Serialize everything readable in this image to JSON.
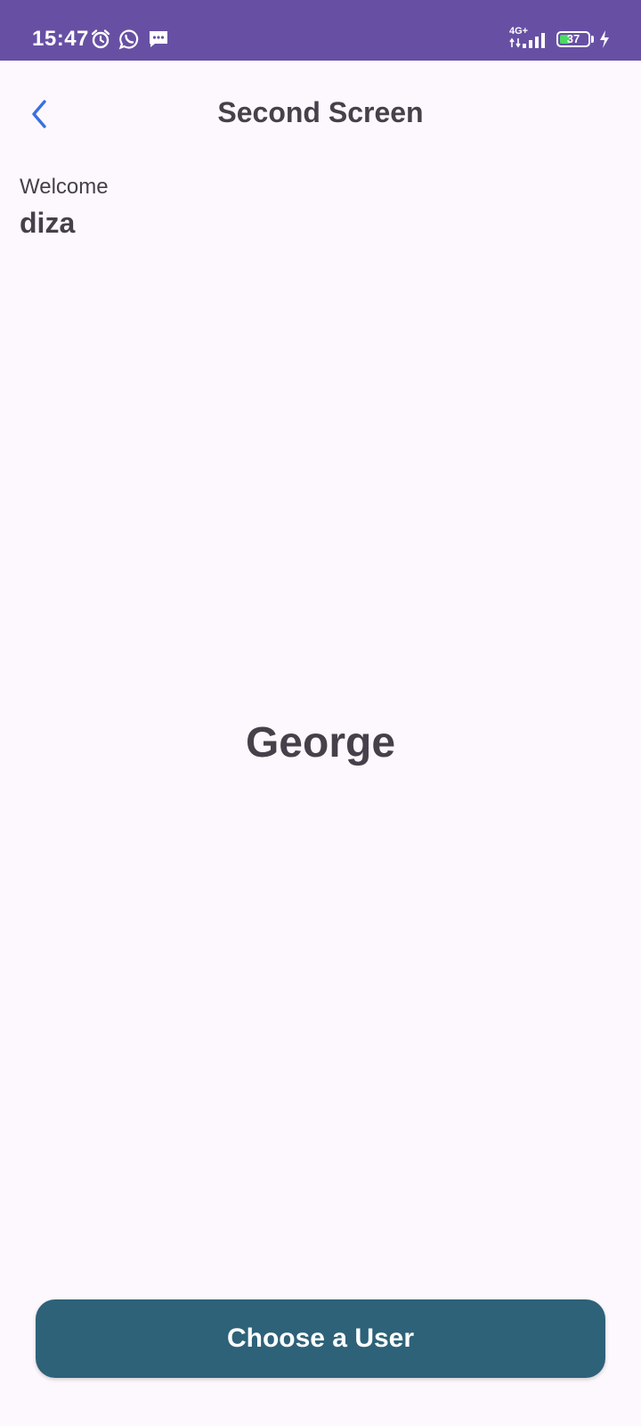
{
  "status_bar": {
    "time": "15:47",
    "network": "4G+",
    "battery_level": "37",
    "battery_fraction": 0.37,
    "background": "#6750a4",
    "icons": [
      "alarm-icon",
      "whatsapp-icon",
      "message-icon",
      "signal-icon",
      "battery-icon",
      "charging-icon"
    ]
  },
  "app_bar": {
    "title": "Second Screen",
    "back_icon": "chevron-left-icon",
    "back_color": "#3b6fe0"
  },
  "welcome": {
    "label": "Welcome",
    "name": "diza"
  },
  "selected_user": {
    "name": "George"
  },
  "actions": {
    "choose_user_label": "Choose a User",
    "button_color": "#2d6279"
  },
  "theme": {
    "background": "#fdf8fd",
    "text": "#45404a"
  }
}
